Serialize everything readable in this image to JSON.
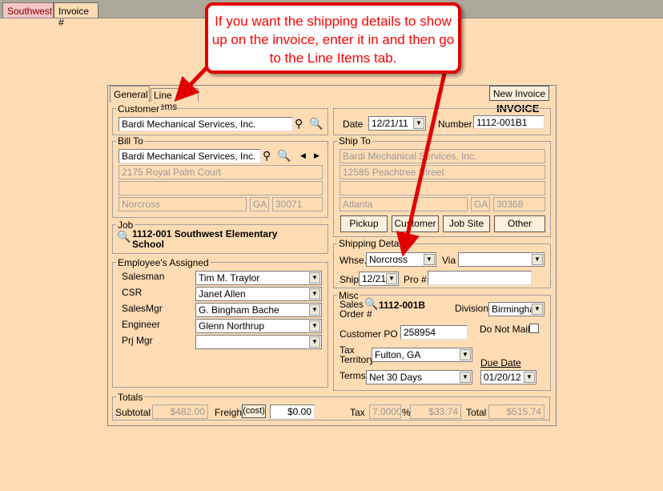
{
  "tabs": {
    "southwest": "Southwest",
    "invoice": "Invoice #"
  },
  "callout": {
    "text": "If you want the shipping details to show up on the invoice, enter it in and then go to the Line Items tab."
  },
  "form": {
    "tab_general": "General",
    "tab_line_items": "Line Items",
    "new_invoice": "New Invoice",
    "invoice_title": "INVOICE",
    "customer": {
      "label": "Customer",
      "value": "Bardi Mechanical Services, Inc."
    },
    "bill_to": {
      "label": "Bill To",
      "name": "Bardi Mechanical Services, Inc.",
      "address1": "2175 Royal Palm Court",
      "address2": "",
      "city": "Norcross",
      "state": "GA",
      "zip": "30071"
    },
    "date": {
      "label": "Date",
      "value": "12/21/11"
    },
    "number": {
      "label": "Number",
      "value": "1112-001B1"
    },
    "ship_to": {
      "label": "Ship To",
      "name": "Bardi Mechanical Services, Inc.",
      "address1": "12585 Peachtree Street",
      "address2": "",
      "city": "Atlanta",
      "state": "GA",
      "zip": "30368"
    },
    "ship_buttons": {
      "pickup": "Pickup",
      "customer": "Customer",
      "job_site": "Job Site",
      "other": "Other"
    },
    "job": {
      "label": "Job",
      "value": "1112-001 Southwest Elementary School"
    },
    "shipping": {
      "label": "Shipping Details",
      "whse_label": "Whse.",
      "whse": "Norcross",
      "via_label": "Via",
      "via": "",
      "ship_label": "Ship",
      "ship": "12/21",
      "pro_label": "Pro #",
      "pro": ""
    },
    "employees": {
      "label": "Employee's Assigned",
      "rows": [
        {
          "label": "Salesman",
          "value": "Tim  M. Traylor"
        },
        {
          "label": "CSR",
          "value": "Janet Allen"
        },
        {
          "label": "SalesMgr",
          "value": "G. Bingham Bache"
        },
        {
          "label": "Engineer",
          "value": "Glenn Northrup"
        },
        {
          "label": "Prj Mgr",
          "value": ""
        }
      ]
    },
    "misc": {
      "label": "Misc",
      "sales_order_label1": "Sales",
      "sales_order_label2": "Order #",
      "sales_order": "1112-001B",
      "division_label": "Division",
      "division": "Birmingha",
      "po_label": "Customer PO #",
      "po": "258954",
      "dnm_label": "Do Not Mail",
      "tax_label1": "Tax",
      "tax_label2": "Territory",
      "tax_territory": "Fulton, GA",
      "terms_label": "Terms",
      "terms": "Net 30 Days",
      "due_label": "Due Date",
      "due": "01/20/12"
    },
    "totals": {
      "label": "Totals",
      "subtotal_label": "Subtotal",
      "subtotal": "$482.00",
      "freight_label": "Freight",
      "cost_button": "(cost)",
      "freight": "$0.00",
      "tax_label": "Tax",
      "tax_rate": "7.0000",
      "pct": "%",
      "tax": "$33.74",
      "total_label": "Total",
      "total": "$515.74"
    }
  },
  "icons": {
    "binoculars": "binoculars-icon",
    "magnifier": "magnifier-icon",
    "arrow_left": "arrow-left-icon",
    "arrow_right": "arrow-right-icon",
    "dropdown": "dropdown-arrow-icon"
  }
}
